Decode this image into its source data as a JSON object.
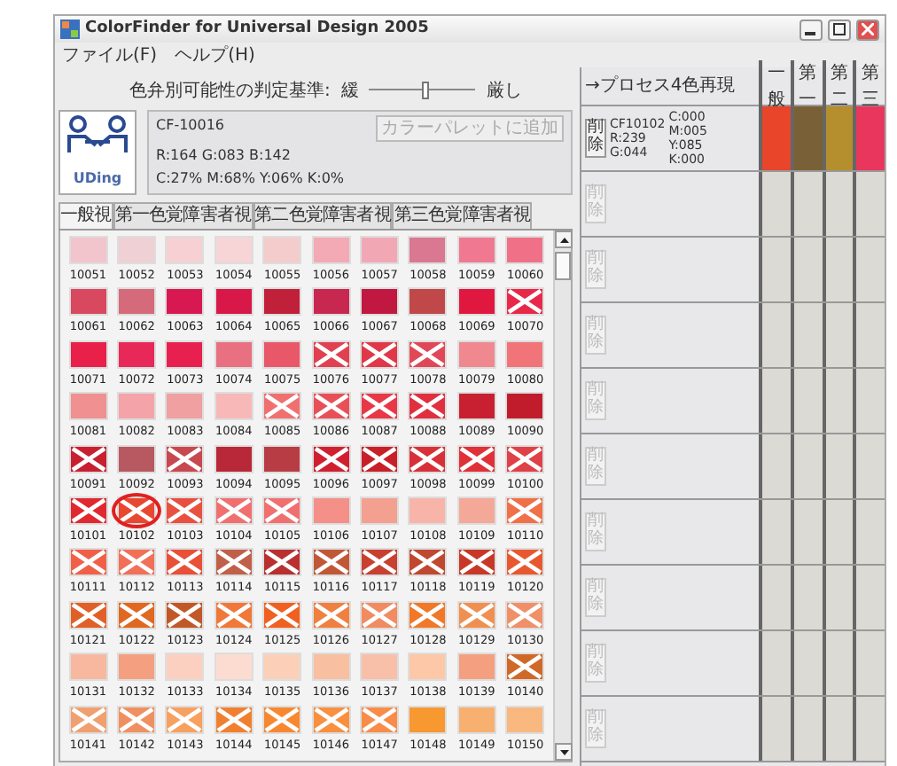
{
  "window": {
    "title": "ColorFinder for Universal Design 2005"
  },
  "menu": [
    "ファイル(F)",
    "ヘルプ(H)"
  ],
  "threshold": {
    "label": "色弁別可能性の判定基準:",
    "low": "緩",
    "high": "厳し",
    "level": 0.55
  },
  "logo": {
    "text": "UDing"
  },
  "selected_color": {
    "code": "CF-10016",
    "rgb": "R:164  G:083  B:142",
    "cmyk": "C:27%  M:68%  Y:06%  K:0%",
    "button": "カラーパレットに追加",
    "button_disabled": true
  },
  "tabs": [
    {
      "label": "一般視",
      "selected": true
    },
    {
      "label": "第一色覚障害者視",
      "selected": false
    },
    {
      "label": "第二色覚障害者視",
      "selected": false
    },
    {
      "label": "第三色覚障害者視",
      "selected": false
    }
  ],
  "swatches": [
    {
      "code": "10051",
      "color": "#f2c4cc",
      "crossed": false,
      "selected": false
    },
    {
      "code": "10052",
      "color": "#efd0d4",
      "crossed": false,
      "selected": false
    },
    {
      "code": "10053",
      "color": "#f7d0d4",
      "crossed": false,
      "selected": false
    },
    {
      "code": "10054",
      "color": "#f7d4d6",
      "crossed": false,
      "selected": false
    },
    {
      "code": "10055",
      "color": "#f4cccc",
      "crossed": false,
      "selected": false
    },
    {
      "code": "10056",
      "color": "#f3aab4",
      "crossed": false,
      "selected": false
    },
    {
      "code": "10057",
      "color": "#f2a8b4",
      "crossed": false,
      "selected": false
    },
    {
      "code": "10058",
      "color": "#d97890",
      "crossed": false,
      "selected": false
    },
    {
      "code": "10059",
      "color": "#f07890",
      "crossed": false,
      "selected": false
    },
    {
      "code": "10060",
      "color": "#f07088",
      "crossed": false,
      "selected": false
    },
    {
      "code": "10061",
      "color": "#d8485e",
      "crossed": false,
      "selected": false
    },
    {
      "code": "10062",
      "color": "#d46a7a",
      "crossed": false,
      "selected": false
    },
    {
      "code": "10063",
      "color": "#d81850",
      "crossed": false,
      "selected": false
    },
    {
      "code": "10064",
      "color": "#d81848",
      "crossed": false,
      "selected": false
    },
    {
      "code": "10065",
      "color": "#c0203a",
      "crossed": false,
      "selected": false
    },
    {
      "code": "10066",
      "color": "#c82850",
      "crossed": false,
      "selected": false
    },
    {
      "code": "10067",
      "color": "#c01840",
      "crossed": false,
      "selected": false
    },
    {
      "code": "10068",
      "color": "#c04848",
      "crossed": false,
      "selected": false
    },
    {
      "code": "10069",
      "color": "#e01840",
      "crossed": false,
      "selected": false
    },
    {
      "code": "10070",
      "color": "#e82848",
      "crossed": true,
      "selected": false
    },
    {
      "code": "10071",
      "color": "#e8204a",
      "crossed": false,
      "selected": false
    },
    {
      "code": "10072",
      "color": "#e82858",
      "crossed": false,
      "selected": false
    },
    {
      "code": "10073",
      "color": "#e82050",
      "crossed": false,
      "selected": false
    },
    {
      "code": "10074",
      "color": "#e87080",
      "crossed": false,
      "selected": false
    },
    {
      "code": "10075",
      "color": "#e85868",
      "crossed": false,
      "selected": false
    },
    {
      "code": "10076",
      "color": "#e04050",
      "crossed": true,
      "selected": false
    },
    {
      "code": "10077",
      "color": "#e03848",
      "crossed": true,
      "selected": false
    },
    {
      "code": "10078",
      "color": "#e04858",
      "crossed": true,
      "selected": false
    },
    {
      "code": "10079",
      "color": "#f08890",
      "crossed": false,
      "selected": false
    },
    {
      "code": "10080",
      "color": "#f07478",
      "crossed": false,
      "selected": false
    },
    {
      "code": "10081",
      "color": "#f09090",
      "crossed": false,
      "selected": false
    },
    {
      "code": "10082",
      "color": "#f4a4a8",
      "crossed": false,
      "selected": false
    },
    {
      "code": "10083",
      "color": "#f0a0a0",
      "crossed": false,
      "selected": false
    },
    {
      "code": "10084",
      "color": "#f8b8b8",
      "crossed": false,
      "selected": false
    },
    {
      "code": "10085",
      "color": "#f07070",
      "crossed": true,
      "selected": false
    },
    {
      "code": "10086",
      "color": "#e85058",
      "crossed": true,
      "selected": false
    },
    {
      "code": "10087",
      "color": "#e83848",
      "crossed": true,
      "selected": false
    },
    {
      "code": "10088",
      "color": "#e03040",
      "crossed": true,
      "selected": false
    },
    {
      "code": "10089",
      "color": "#c82030",
      "crossed": false,
      "selected": false
    },
    {
      "code": "10090",
      "color": "#c01c2c",
      "crossed": false,
      "selected": false
    },
    {
      "code": "10091",
      "color": "#c82030",
      "crossed": true,
      "selected": false
    },
    {
      "code": "10092",
      "color": "#b85860",
      "crossed": false,
      "selected": false
    },
    {
      "code": "10093",
      "color": "#c84850",
      "crossed": true,
      "selected": false
    },
    {
      "code": "10094",
      "color": "#b82838",
      "crossed": false,
      "selected": false
    },
    {
      "code": "10095",
      "color": "#b83c44",
      "crossed": false,
      "selected": false
    },
    {
      "code": "10096",
      "color": "#d02030",
      "crossed": true,
      "selected": false
    },
    {
      "code": "10097",
      "color": "#c82028",
      "crossed": true,
      "selected": false
    },
    {
      "code": "10098",
      "color": "#d83038",
      "crossed": true,
      "selected": false
    },
    {
      "code": "10099",
      "color": "#e03038",
      "crossed": true,
      "selected": false
    },
    {
      "code": "10100",
      "color": "#e04048",
      "crossed": true,
      "selected": false
    },
    {
      "code": "10101",
      "color": "#e02830",
      "crossed": true,
      "selected": false
    },
    {
      "code": "10102",
      "color": "#e84830",
      "crossed": true,
      "selected": true
    },
    {
      "code": "10103",
      "color": "#e85040",
      "crossed": true,
      "selected": false
    },
    {
      "code": "10104",
      "color": "#f07070",
      "crossed": true,
      "selected": false
    },
    {
      "code": "10105",
      "color": "#f07070",
      "crossed": true,
      "selected": false
    },
    {
      "code": "10106",
      "color": "#f49088",
      "crossed": false,
      "selected": false
    },
    {
      "code": "10107",
      "color": "#f4a090",
      "crossed": false,
      "selected": false
    },
    {
      "code": "10108",
      "color": "#f8b4a8",
      "crossed": false,
      "selected": false
    },
    {
      "code": "10109",
      "color": "#f4a898",
      "crossed": false,
      "selected": false
    },
    {
      "code": "10110",
      "color": "#f07048",
      "crossed": true,
      "selected": false
    },
    {
      "code": "10111",
      "color": "#f06048",
      "crossed": true,
      "selected": false
    },
    {
      "code": "10112",
      "color": "#f07058",
      "crossed": true,
      "selected": false
    },
    {
      "code": "10113",
      "color": "#e85038",
      "crossed": true,
      "selected": false
    },
    {
      "code": "10114",
      "color": "#c06048",
      "crossed": true,
      "selected": false
    },
    {
      "code": "10115",
      "color": "#b83030",
      "crossed": true,
      "selected": false
    },
    {
      "code": "10116",
      "color": "#c05838",
      "crossed": true,
      "selected": false
    },
    {
      "code": "10117",
      "color": "#c84030",
      "crossed": true,
      "selected": false
    },
    {
      "code": "10118",
      "color": "#c04830",
      "crossed": true,
      "selected": false
    },
    {
      "code": "10119",
      "color": "#c83828",
      "crossed": true,
      "selected": false
    },
    {
      "code": "10120",
      "color": "#e85830",
      "crossed": true,
      "selected": false
    },
    {
      "code": "10121",
      "color": "#e06028",
      "crossed": true,
      "selected": false
    },
    {
      "code": "10122",
      "color": "#e06820",
      "crossed": true,
      "selected": false
    },
    {
      "code": "10123",
      "color": "#c05828",
      "crossed": true,
      "selected": false
    },
    {
      "code": "10124",
      "color": "#f07838",
      "crossed": true,
      "selected": false
    },
    {
      "code": "10125",
      "color": "#f06020",
      "crossed": true,
      "selected": false
    },
    {
      "code": "10126",
      "color": "#f08040",
      "crossed": true,
      "selected": false
    },
    {
      "code": "10127",
      "color": "#f08c60",
      "crossed": true,
      "selected": false
    },
    {
      "code": "10128",
      "color": "#f07828",
      "crossed": true,
      "selected": false
    },
    {
      "code": "10129",
      "color": "#f09050",
      "crossed": true,
      "selected": false
    },
    {
      "code": "10130",
      "color": "#f09068",
      "crossed": true,
      "selected": false
    },
    {
      "code": "10131",
      "color": "#f8b8a0",
      "crossed": false,
      "selected": false
    },
    {
      "code": "10132",
      "color": "#f4a080",
      "crossed": false,
      "selected": false
    },
    {
      "code": "10133",
      "color": "#fcd0c0",
      "crossed": false,
      "selected": false
    },
    {
      "code": "10134",
      "color": "#fcdcd0",
      "crossed": false,
      "selected": false
    },
    {
      "code": "10135",
      "color": "#fcd0b8",
      "crossed": false,
      "selected": false
    },
    {
      "code": "10136",
      "color": "#f8c0a0",
      "crossed": false,
      "selected": false
    },
    {
      "code": "10137",
      "color": "#f8c0a8",
      "crossed": false,
      "selected": false
    },
    {
      "code": "10138",
      "color": "#fcc8a8",
      "crossed": false,
      "selected": false
    },
    {
      "code": "10139",
      "color": "#f4a080",
      "crossed": false,
      "selected": false
    },
    {
      "code": "10140",
      "color": "#d06828",
      "crossed": true,
      "selected": false
    },
    {
      "code": "10141",
      "color": "#f0a070",
      "crossed": true,
      "selected": false
    },
    {
      "code": "10142",
      "color": "#f09060",
      "crossed": true,
      "selected": false
    },
    {
      "code": "10143",
      "color": "#f8a060",
      "crossed": true,
      "selected": false
    },
    {
      "code": "10144",
      "color": "#f08030",
      "crossed": true,
      "selected": false
    },
    {
      "code": "10145",
      "color": "#f88830",
      "crossed": true,
      "selected": false
    },
    {
      "code": "10146",
      "color": "#f89040",
      "crossed": true,
      "selected": false
    },
    {
      "code": "10147",
      "color": "#f88c48",
      "crossed": true,
      "selected": false
    },
    {
      "code": "10148",
      "color": "#f89830",
      "crossed": false,
      "selected": false
    },
    {
      "code": "10149",
      "color": "#f8b070",
      "crossed": false,
      "selected": false
    },
    {
      "code": "10150",
      "color": "#f8b880",
      "crossed": false,
      "selected": false
    }
  ],
  "palette": {
    "title": "→プロセス4色再現",
    "columns": [
      "一般",
      "第一",
      "第二",
      "第三"
    ],
    "rows": [
      {
        "code": "CF10102",
        "rgb": [
          "R:239",
          "G:044"
        ],
        "cmyk": [
          "C:000",
          "M:005",
          "Y:085",
          "K:000"
        ],
        "simulations": [
          {
            "color": "#e8452a"
          },
          {
            "color": "#7a6036"
          },
          {
            "color": "#b58e2e"
          },
          {
            "color": "#e8365c"
          }
        ],
        "delete": "削除",
        "disabled": false
      },
      {
        "delete": "削除",
        "disabled": true
      },
      {
        "delete": "削除",
        "disabled": true
      },
      {
        "delete": "削除",
        "disabled": true
      },
      {
        "delete": "削除",
        "disabled": true
      },
      {
        "delete": "削除",
        "disabled": true
      },
      {
        "delete": "削除",
        "disabled": true
      },
      {
        "delete": "削除",
        "disabled": true
      },
      {
        "delete": "削除",
        "disabled": true
      },
      {
        "delete": "削除",
        "disabled": true
      }
    ]
  }
}
